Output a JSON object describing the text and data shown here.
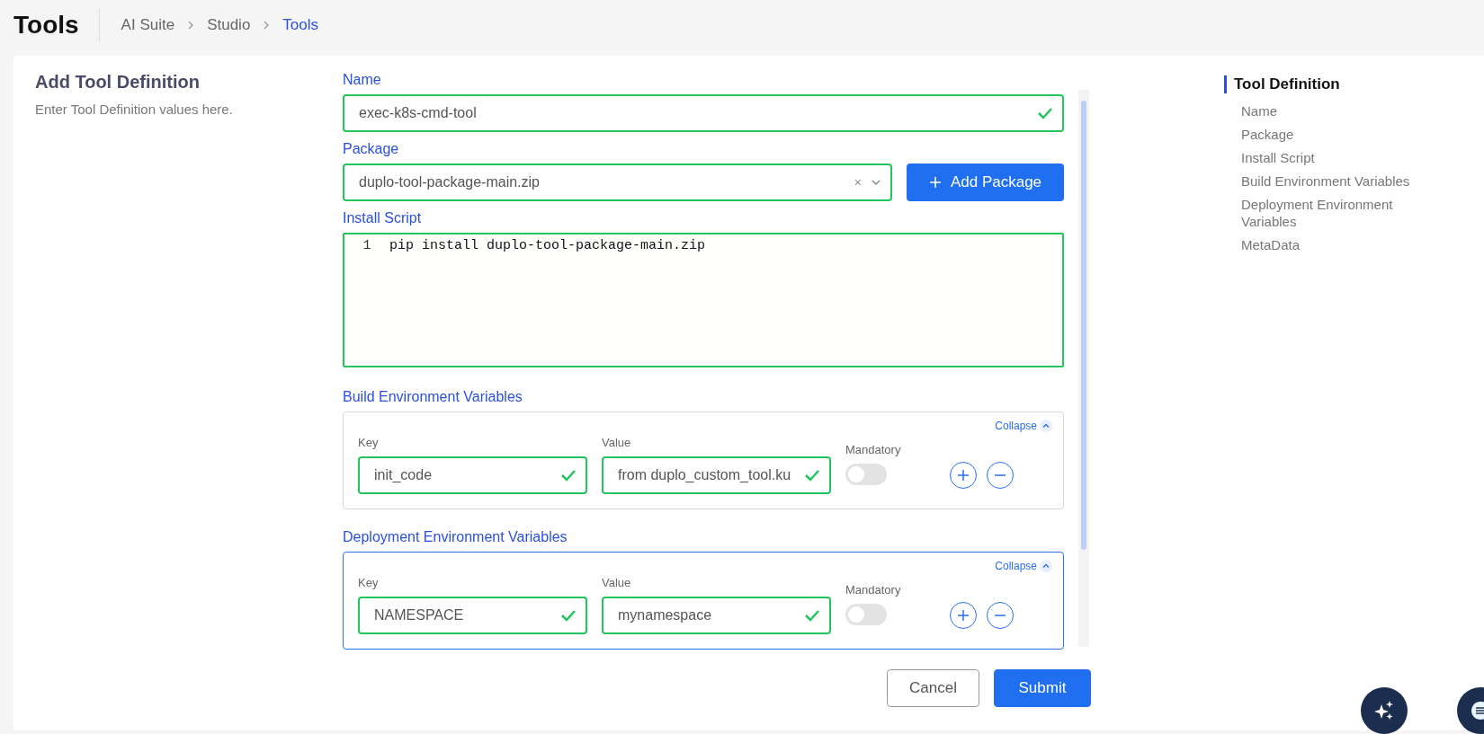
{
  "header": {
    "title": "Tools",
    "breadcrumb": [
      {
        "label": "AI Suite",
        "current": false
      },
      {
        "label": "Studio",
        "current": false
      },
      {
        "label": "Tools",
        "current": true
      }
    ]
  },
  "intro": {
    "title": "Add Tool Definition",
    "description": "Enter Tool Definition values here."
  },
  "form": {
    "name": {
      "label": "Name",
      "value": "exec-k8s-cmd-tool",
      "valid": true
    },
    "package": {
      "label": "Package",
      "value": "duplo-tool-package-main.zip",
      "clear": "×",
      "add_button": "Add Package"
    },
    "install_script": {
      "label": "Install Script",
      "lines": [
        {
          "number": "1",
          "code": "pip install duplo-tool-package-main.zip"
        }
      ]
    },
    "env_sections": [
      {
        "label": "Build Environment Variables",
        "collapse": "Collapse",
        "focused": false,
        "rows": [
          {
            "key_label": "Key",
            "key": "init_code",
            "key_valid": true,
            "value_label": "Value",
            "value": "from duplo_custom_tool.ku",
            "value_valid": true,
            "mandatory_label": "Mandatory",
            "mandatory": false
          }
        ]
      },
      {
        "label": "Deployment Environment Variables",
        "collapse": "Collapse",
        "focused": true,
        "rows": [
          {
            "key_label": "Key",
            "key": "NAMESPACE",
            "key_valid": true,
            "value_label": "Value",
            "value": "mynamespace",
            "value_valid": true,
            "mandatory_label": "Mandatory",
            "mandatory": false
          }
        ]
      }
    ],
    "buttons": [
      {
        "label": "Cancel",
        "kind": "secondary"
      },
      {
        "label": "Submit",
        "kind": "primary"
      }
    ]
  },
  "nav": {
    "title": "Tool Definition",
    "items": [
      "Name",
      "Package",
      "Install Script",
      "Build Environment Variables",
      "Deployment Environment Variables",
      "MetaData"
    ]
  }
}
